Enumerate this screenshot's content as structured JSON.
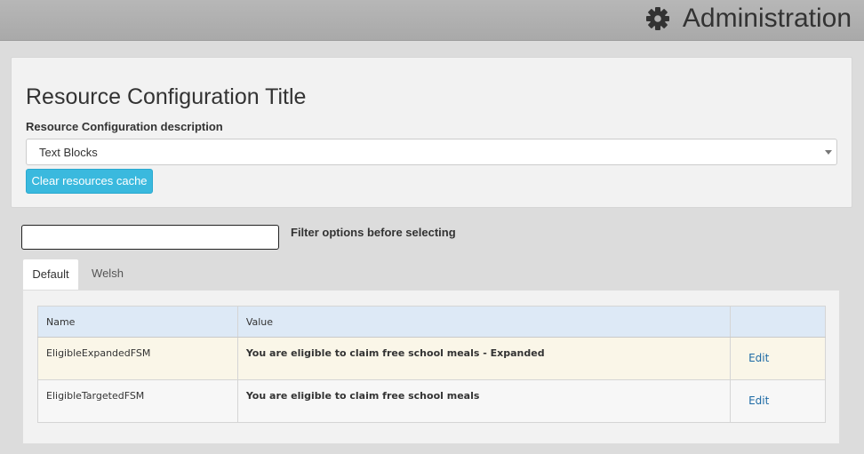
{
  "header": {
    "title": "Administration",
    "icon": "gear-icon"
  },
  "config": {
    "title": "Resource Configuration Title",
    "description_label": "Resource Configuration description",
    "select": {
      "selected_value": "Text Blocks"
    },
    "clear_cache_label": "Clear resources cache"
  },
  "filter": {
    "value": "",
    "label": "Filter options before selecting"
  },
  "tabs": [
    {
      "label": "Default",
      "active": true
    },
    {
      "label": "Welsh",
      "active": false
    }
  ],
  "table": {
    "headers": [
      "Name",
      "Value",
      ""
    ],
    "rows": [
      {
        "name": "EligibleExpandedFSM",
        "value": "You are eligible to claim free school meals - Expanded",
        "action": "Edit"
      },
      {
        "name": "EligibleTargetedFSM",
        "value": "You are eligible to claim free school meals",
        "action": "Edit"
      }
    ]
  },
  "colors": {
    "accent_button": "#3ab9de",
    "link": "#1d6aa5",
    "header_row": "#dde9f6",
    "highlight_row": "#faf6e8"
  }
}
